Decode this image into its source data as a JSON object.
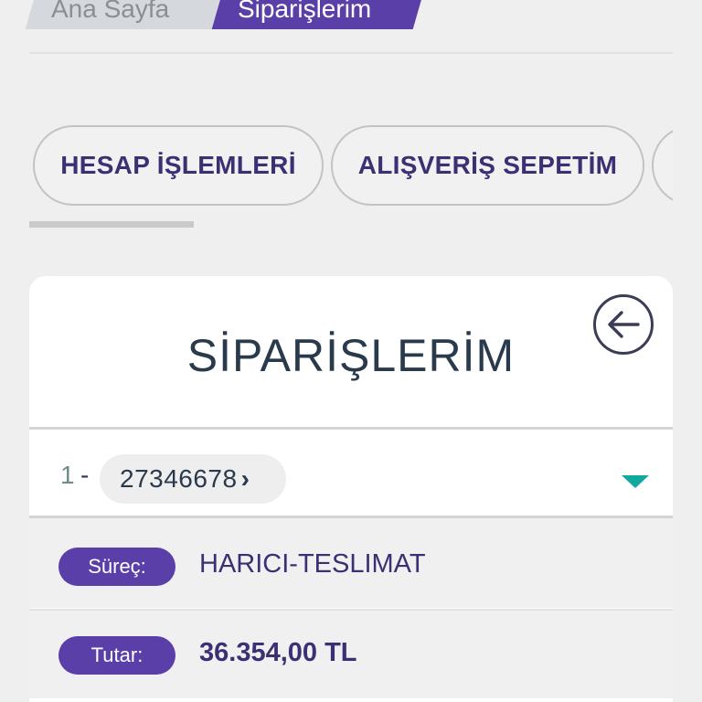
{
  "breadcrumb": {
    "home_label": "Ana Sayfa",
    "current_label": "Siparişlerim"
  },
  "tabs": [
    {
      "label": "HESAP İŞLEMLERİ"
    },
    {
      "label": "ALIŞVERİŞ SEPETİM"
    },
    {
      "label": ""
    }
  ],
  "card": {
    "title": "SİPARİŞLERİM",
    "back_icon": "arrow-left-circle-icon"
  },
  "order": {
    "index": "1",
    "separator": "-",
    "number": "27346678",
    "chevron": "›",
    "expand_icon": "caret-down-icon"
  },
  "details": [
    {
      "label": "Süreç:",
      "value": "HARICI-TESLIMAT"
    },
    {
      "label": "Tutar:",
      "value": "36.354,00 TL"
    }
  ],
  "colors": {
    "brand_purple": "#5a3fa8",
    "title_text": "#2a3a4d",
    "tab_text": "#3d2f73",
    "accent_teal": "#11a8a0"
  }
}
